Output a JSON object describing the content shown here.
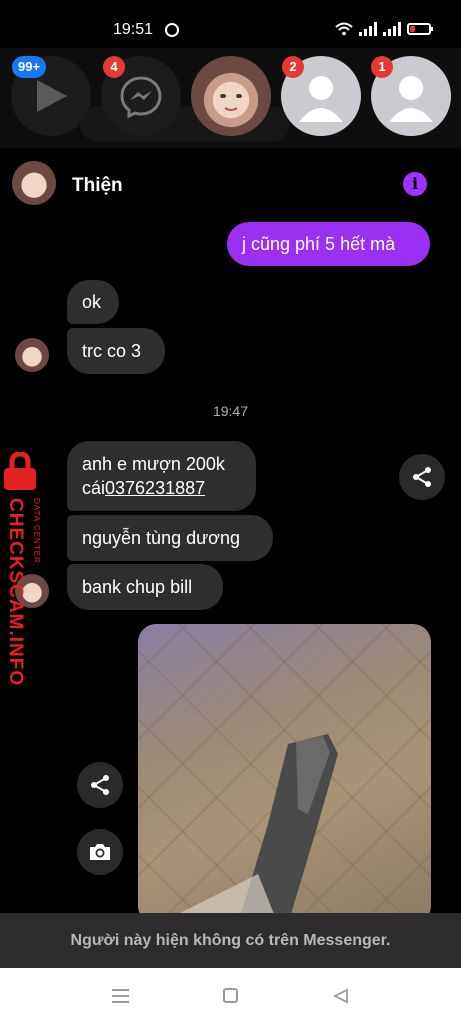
{
  "status_bar": {
    "time": "19:51"
  },
  "chat_heads": [
    {
      "badge": "99+",
      "badge_color": "#1877f2",
      "icon": "play-icon"
    },
    {
      "badge": "4",
      "badge_color": "#e53935",
      "icon": "messenger-icon"
    },
    {
      "badge": "",
      "icon": "profile-photo"
    },
    {
      "badge": "2",
      "badge_color": "#e53935",
      "icon": "default-avatar-icon"
    },
    {
      "badge": "1",
      "badge_color": "#e53935",
      "icon": "default-avatar-icon"
    }
  ],
  "conversation": {
    "name": "Thiện",
    "accent_color": "#a033ff",
    "messages": {
      "m1": "j cũng phí 5 hết mà",
      "m2": "ok",
      "m3": "trc co 3",
      "timestamp": "19:47",
      "m4_line1": "anh e mượn 200k",
      "m4_prefix": "cái",
      "m4_link": "0376231887",
      "m5": "nguyễn tùng dương",
      "m6": "bank chup bill"
    }
  },
  "watermark": {
    "text": "CHECKSCAM.INFO",
    "subtext": "DATA CENTER"
  },
  "notice": "Người này hiện không có trên Messenger."
}
